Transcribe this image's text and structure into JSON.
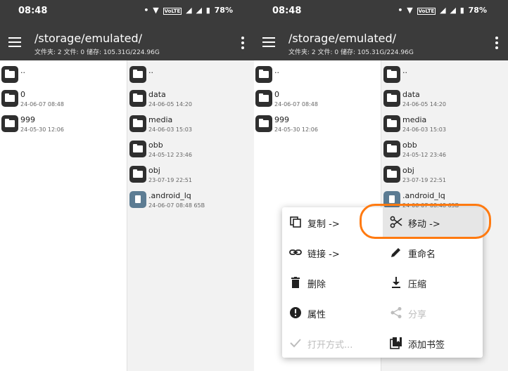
{
  "status": {
    "time": "08:48",
    "dot": "•",
    "battery": "78%",
    "indicators": [
      "▼",
      "VoLTE",
      "◢",
      "◢",
      "▮"
    ]
  },
  "toolbar": {
    "title": "/storage/emulated/",
    "subtitle": "文件夹: 2  文件: 0  储存: 105.31G/224.96G"
  },
  "left_pane": {
    "items": [
      {
        "name": "..",
        "date": "",
        "type": "folder"
      },
      {
        "name": "0",
        "date": "24-06-07 08:48",
        "type": "folder"
      },
      {
        "name": "999",
        "date": "24-05-30 12:06",
        "type": "folder"
      }
    ]
  },
  "right_pane": {
    "items": [
      {
        "name": "..",
        "date": "",
        "type": "folder"
      },
      {
        "name": "data",
        "date": "24-06-05 14:20",
        "type": "folder"
      },
      {
        "name": "media",
        "date": "24-06-03 15:03",
        "type": "folder"
      },
      {
        "name": "obb",
        "date": "24-05-12 23:46",
        "type": "folder"
      },
      {
        "name": "obj",
        "date": "23-07-19 22:51",
        "type": "folder"
      },
      {
        "name": ".android_lq",
        "date": "24-06-07 08:48  65B",
        "type": "file"
      }
    ]
  },
  "context_menu": {
    "items": [
      {
        "label": "复制 ->",
        "icon": "copy-icon",
        "enabled": true
      },
      {
        "label": "移动 ->",
        "icon": "scissors-icon",
        "enabled": true,
        "highlighted": true
      },
      {
        "label": "链接 ->",
        "icon": "link-icon",
        "enabled": true
      },
      {
        "label": "重命名",
        "icon": "pencil-icon",
        "enabled": true
      },
      {
        "label": "删除",
        "icon": "trash-icon",
        "enabled": true
      },
      {
        "label": "压缩",
        "icon": "download-icon",
        "enabled": true
      },
      {
        "label": "属性",
        "icon": "info-icon",
        "enabled": true
      },
      {
        "label": "分享",
        "icon": "share-icon",
        "enabled": false
      },
      {
        "label": "打开方式...",
        "icon": "check-icon",
        "enabled": false
      },
      {
        "label": "添加书签",
        "icon": "bookmark-icon",
        "enabled": true
      }
    ]
  },
  "colors": {
    "toolbar": "#3b3b3b",
    "highlight_ring": "#ff7a10",
    "folder_icon": "#2f2f2f",
    "file_icon": "#5c7c93"
  }
}
